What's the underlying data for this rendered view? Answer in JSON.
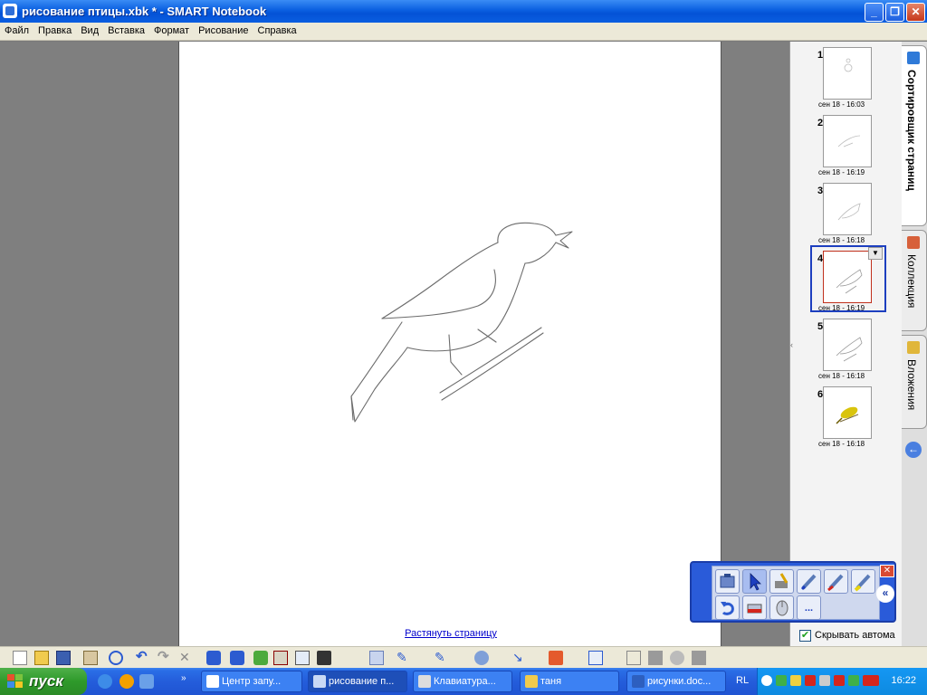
{
  "window": {
    "title": "рисование птицы.xbk * - SMART Notebook",
    "min_glyph": "_",
    "max_glyph": "❐",
    "close_glyph": "✕"
  },
  "menu": [
    "Файл",
    "Правка",
    "Вид",
    "Вставка",
    "Формат",
    "Рисование",
    "Справка"
  ],
  "page": {
    "extend_link": "Растянуть страницу"
  },
  "thumbnails": [
    {
      "num": "1",
      "date": "сен 18 - 16:03",
      "selected": false
    },
    {
      "num": "2",
      "date": "сен 18 - 16:19",
      "selected": false
    },
    {
      "num": "3",
      "date": "сен 18 - 16:18",
      "selected": false
    },
    {
      "num": "4",
      "date": "сен 18 - 16:19",
      "selected": true
    },
    {
      "num": "5",
      "date": "сен 18 - 16:18",
      "selected": false
    },
    {
      "num": "6",
      "date": "сен 18 - 16:18",
      "selected": false
    }
  ],
  "tabs": [
    {
      "label": "Сортировщик страниц",
      "icon": "page-sorter-icon",
      "active": true
    },
    {
      "label": "Коллекция",
      "icon": "gallery-icon",
      "active": false
    },
    {
      "label": "Вложения",
      "icon": "attachments-icon",
      "active": false
    }
  ],
  "autohide": {
    "label": "Скрывать автома",
    "checked": true
  },
  "floating_tools": {
    "close_glyph": "✕",
    "collapse_glyph": "«",
    "more_glyph": "..."
  },
  "taskbar": {
    "start": "пуск",
    "tasks": [
      {
        "label": "Центр запу...",
        "active": false
      },
      {
        "label": "рисование п...",
        "active": true
      },
      {
        "label": "Клавиатура...",
        "active": false
      },
      {
        "label": "таня",
        "active": false
      },
      {
        "label": "рисунки.doc...",
        "active": false
      }
    ],
    "lang": "RL",
    "clock": "16:22"
  },
  "colors": {
    "accent": "#1d3fbf",
    "titlebar": "#0a5fe0",
    "taskbar": "#245ddb",
    "tray": "#0d8ae0"
  }
}
